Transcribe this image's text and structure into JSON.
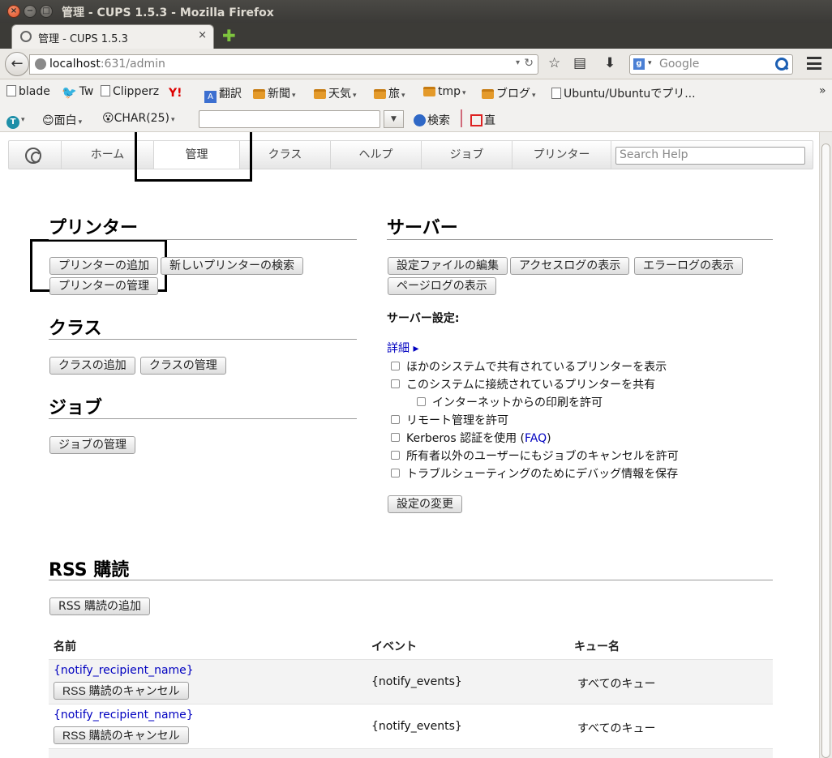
{
  "window": {
    "title": "管理 - CUPS 1.5.3 - Mozilla Firefox",
    "close_glyph": "×",
    "min_glyph": "−",
    "max_glyph": "□"
  },
  "tab": {
    "label": "管理 - CUPS 1.5.3",
    "close": "×",
    "new_tab": "✚"
  },
  "urlbar": {
    "host": "localhost",
    "path": ":631/admin"
  },
  "nav": {
    "back": "←",
    "dropdown": "▾",
    "reload": "↻",
    "star": "☆",
    "reader": "▤",
    "download": "⬇"
  },
  "search": {
    "placeholder": "Google",
    "engine": "g",
    "engine_drop": "▾"
  },
  "bookmarks": [
    {
      "label": "blade",
      "icon": "page-icon"
    },
    {
      "label": "Tw",
      "icon": "twitter-icon",
      "glyph": "🐦"
    },
    {
      "label": "Clipperz",
      "icon": "page-icon"
    },
    {
      "label": "Y!",
      "icon": "yahoo-icon",
      "glyph": "Y!"
    },
    {
      "label": "翻訳",
      "icon": "translate-icon",
      "glyph": "A"
    },
    {
      "label": "新聞",
      "icon": "folder-icon",
      "drop": "▾"
    },
    {
      "label": "天気",
      "icon": "folder-icon",
      "drop": "▾"
    },
    {
      "label": "旅",
      "icon": "folder-icon",
      "drop": "▾"
    },
    {
      "label": "tmp",
      "icon": "folder-icon",
      "drop": "▾"
    },
    {
      "label": "ブログ",
      "icon": "folder-icon",
      "drop": "▾"
    },
    {
      "label": "Ubuntu/Ubuntuでプリ...",
      "icon": "page-icon"
    }
  ],
  "bookmarks_more": "»",
  "toolbar2": {
    "t_icon": "T",
    "t_drop": "▾",
    "omoshiro": "面白",
    "omoshiro_glyph": "😊",
    "char": "CHAR(25)",
    "char_glyph": "😮",
    "dd": "▼",
    "search": "検索",
    "direct": "直"
  },
  "cups_nav": {
    "tabs": [
      "ホーム",
      "管理",
      "クラス",
      "ヘルプ",
      "ジョブ",
      "プリンター"
    ],
    "active": "管理",
    "search_placeholder": "Search Help"
  },
  "printers": {
    "heading": "プリンター",
    "buttons": [
      "プリンターの追加",
      "新しいプリンターの検索",
      "プリンターの管理"
    ]
  },
  "classes": {
    "heading": "クラス",
    "buttons": [
      "クラスの追加",
      "クラスの管理"
    ]
  },
  "jobs": {
    "heading": "ジョブ",
    "buttons": [
      "ジョブの管理"
    ]
  },
  "server": {
    "heading": "サーバー",
    "buttons": [
      "設定ファイルの編集",
      "アクセスログの表示",
      "エラーログの表示",
      "ページログの表示"
    ],
    "settings_label": "サーバー設定:",
    "advanced": "詳細 ▸",
    "options": [
      "ほかのシステムで共有されているプリンターを表示",
      "このシステムに接続されているプリンターを共有",
      "インターネットからの印刷を許可",
      "リモート管理を許可",
      "所有者以外のユーザーにもジョブのキャンセルを許可",
      "トラブルシューティングのためにデバッグ情報を保存"
    ],
    "kerberos_prefix": "Kerberos 認証を使用 (",
    "kerberos_link": "FAQ",
    "kerberos_suffix": ")",
    "change_button": "設定の変更"
  },
  "rss": {
    "heading": "RSS 購読",
    "add_button": "RSS 購読の追加",
    "columns": [
      "名前",
      "イベント",
      "キュー名"
    ],
    "rows": [
      {
        "name": "{notify_recipient_name}",
        "cancel": "RSS 購読のキャンセル",
        "events": "{notify_events}",
        "queue": "すべてのキュー"
      },
      {
        "name": "{notify_recipient_name}",
        "cancel": "RSS 購読のキャンセル",
        "events": "{notify_events}",
        "queue": "すべてのキュー"
      }
    ]
  }
}
